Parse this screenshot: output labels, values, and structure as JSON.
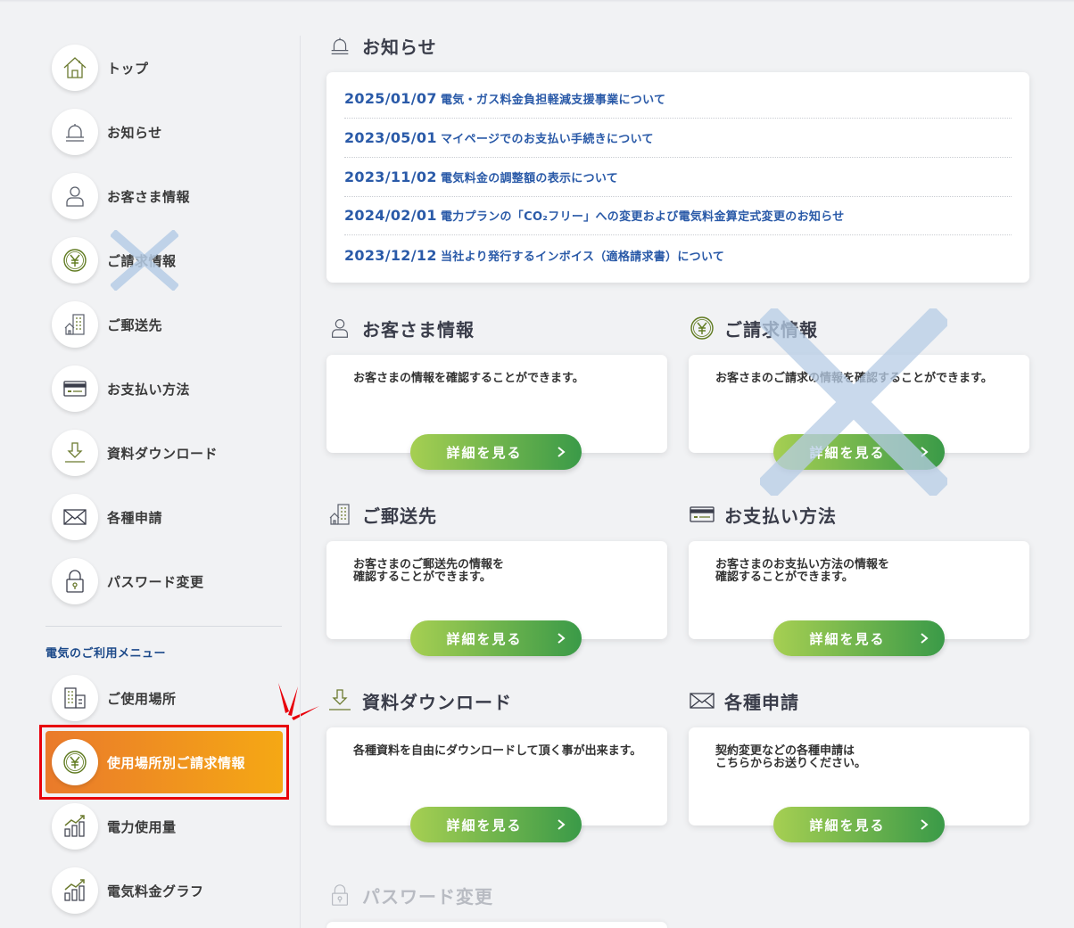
{
  "sidebar": {
    "items": [
      {
        "label": "トップ",
        "icon": "home-icon"
      },
      {
        "label": "お知らせ",
        "icon": "bell-icon"
      },
      {
        "label": "お客さま情報",
        "icon": "user-icon"
      },
      {
        "label": "ご請求情報",
        "icon": "yen-icon"
      },
      {
        "label": "ご郵送先",
        "icon": "building-icon"
      },
      {
        "label": "お支払い方法",
        "icon": "card-icon"
      },
      {
        "label": "資料ダウンロード",
        "icon": "download-icon"
      },
      {
        "label": "各種申請",
        "icon": "mail-icon"
      },
      {
        "label": "パスワード変更",
        "icon": "lock-icon"
      }
    ],
    "section_label": "電気のご利用メニュー",
    "electric_items": [
      {
        "label": "ご使用場所",
        "icon": "location-building-icon"
      },
      {
        "label": "使用場所別ご請求情報",
        "icon": "yen-icon",
        "active": true
      },
      {
        "label": "電力使用量",
        "icon": "usage-chart-icon"
      },
      {
        "label": "電気料金グラフ",
        "icon": "graph-icon"
      }
    ]
  },
  "news": {
    "title": "お知らせ",
    "items": [
      {
        "date": "2025/01/07",
        "text": "電気・ガス料金負担軽減支援事業について"
      },
      {
        "date": "2023/05/01",
        "text": "マイページでのお支払い手続きについて"
      },
      {
        "date": "2023/11/02",
        "text": "電気料金の調整額の表示について"
      },
      {
        "date": "2024/02/01",
        "text": "電力プランの「CO₂フリー」への変更および電気料金算定式変更のお知らせ"
      },
      {
        "date": "2023/12/12",
        "text": "当社より発行するインボイス（適格請求書）について"
      }
    ]
  },
  "sections": [
    {
      "title": "お客さま情報",
      "desc": "お客さまの情報を確認することができます。",
      "button": "詳細を見る"
    },
    {
      "title": "ご請求情報",
      "desc": "お客さまのご請求の情報を確認することができます。",
      "button": "詳細を見る"
    },
    {
      "title": "ご郵送先",
      "desc": "お客さまのご郵送先の情報を\n確認することができます。",
      "button": "詳細を見る"
    },
    {
      "title": "お支払い方法",
      "desc": "お客さまのお支払い方法の情報を\n確認することができます。",
      "button": "詳細を見る"
    },
    {
      "title": "資料ダウンロード",
      "desc": "各種資料を自由にダウンロードして頂く事が出来ます。",
      "button": "詳細を見る"
    },
    {
      "title": "各種申請",
      "desc": "契約変更などの各種申請は\nこちらからお送りください。",
      "button": "詳細を見る"
    },
    {
      "title": "パスワード変更",
      "disabled": true
    }
  ],
  "colors": {
    "accent_blue": "#2a5aa8",
    "button_green_start": "#a6cf52",
    "button_green_end": "#3a9a48",
    "active_orange_start": "#ea7a2b",
    "active_orange_end": "#f5a814",
    "highlight_red": "#e8000b",
    "cross_mark": "#b7cde6"
  }
}
